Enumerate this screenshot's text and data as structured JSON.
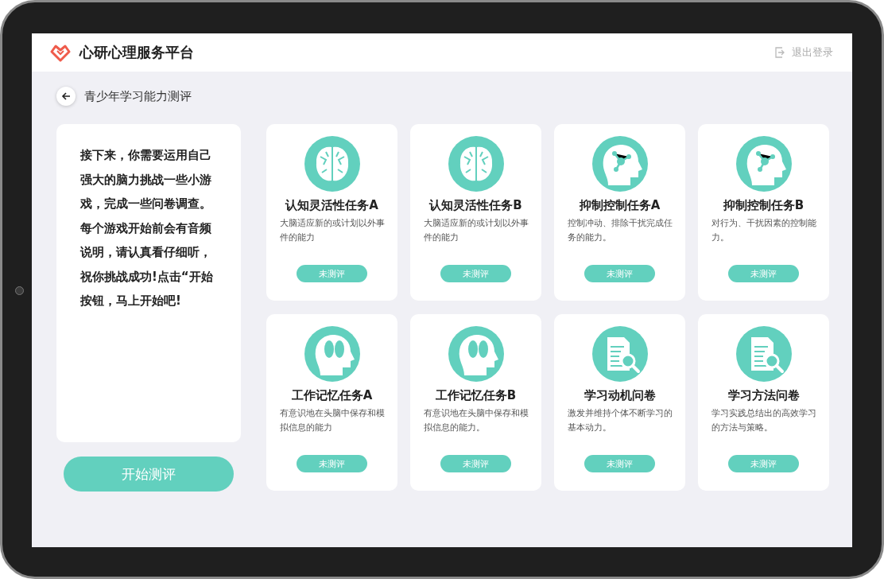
{
  "header": {
    "brand": "心研心理服务平台",
    "logout": "退出登录"
  },
  "page_title": "青少年学习能力测评",
  "intro": "接下来，你需要运用自己强大的脑力挑战一些小游戏，完成一些问卷调查。每个游戏开始前会有音频说明，请认真看仔细听，祝你挑战成功!点击“开始按钮，马上开始吧!",
  "start_button": "开始测评",
  "tasks": [
    {
      "kind": "brain",
      "title": "认知灵活性任务A",
      "description": "大脑适应新的或计划以外事件的能力",
      "status": "未测评"
    },
    {
      "kind": "brain",
      "title": "认知灵活性任务B",
      "description": "大脑适应新的或计划以外事件的能力",
      "status": "未测评"
    },
    {
      "kind": "head-network",
      "title": "抑制控制任务A",
      "description": "控制冲动、排除干扰完成任务的能力。",
      "status": "未测评"
    },
    {
      "kind": "head-network",
      "title": "抑制控制任务B",
      "description": "对行为、干扰因素的控制能力。",
      "status": "未测评"
    },
    {
      "kind": "head-brain",
      "title": "工作记忆任务A",
      "description": "有意识地在头脑中保存和模拟信息的能力",
      "status": "未测评"
    },
    {
      "kind": "head-brain",
      "title": "工作记忆任务B",
      "description": "有意识地在头脑中保存和模拟信息的能力。",
      "status": "未测评"
    },
    {
      "kind": "document",
      "title": "学习动机问卷",
      "description": "激发并维持个体不断学习的基本动力。",
      "status": "未测评"
    },
    {
      "kind": "document",
      "title": "学习方法问卷",
      "description": "学习实践总结出的高效学习的方法与策略。",
      "status": "未测评"
    }
  ]
}
